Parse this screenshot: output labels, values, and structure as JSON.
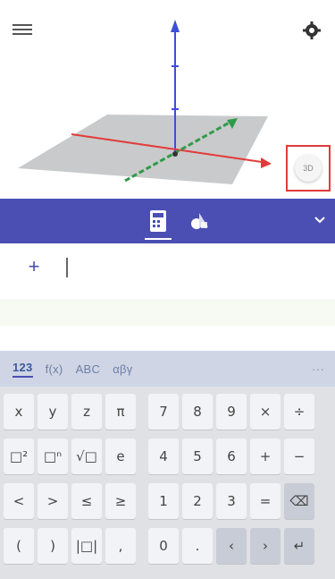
{
  "graphics": {
    "menu_icon": "hamburger-icon",
    "settings_icon": "gear-icon",
    "view_button_icon": "rotate-view-icon",
    "view_button_label": "3D",
    "axis_colors": {
      "x": "#e23a3a",
      "y": "#2f9b4a",
      "z": "#3d4fd6"
    },
    "highlight_color": "#e23a3a"
  },
  "toolbar": {
    "algebra_tab_icon": "calculator-icon",
    "tools_tab_icon": "tools-icon",
    "collapse_icon": "chevron-down-icon",
    "band_color": "#4b4fb3"
  },
  "algebra": {
    "add_label": "+",
    "input_value": ""
  },
  "keyboard": {
    "tabs": [
      {
        "label": "123",
        "active": true
      },
      {
        "label": "f(x)",
        "active": false
      },
      {
        "label": "ABC",
        "active": false
      },
      {
        "label": "αβγ",
        "active": false
      }
    ],
    "more_label": "···",
    "rows": [
      [
        "x",
        "y",
        "z",
        "π",
        "7",
        "8",
        "9",
        "×",
        "÷"
      ],
      [
        "□²",
        "□ⁿ",
        "√□",
        "e",
        "4",
        "5",
        "6",
        "+",
        "−"
      ],
      [
        "<",
        ">",
        "≤",
        "≥",
        "1",
        "2",
        "3",
        "=",
        "⌫"
      ],
      [
        "(",
        ")",
        "|□|",
        ",",
        "0",
        ".",
        "‹",
        "›",
        "↵"
      ]
    ]
  }
}
